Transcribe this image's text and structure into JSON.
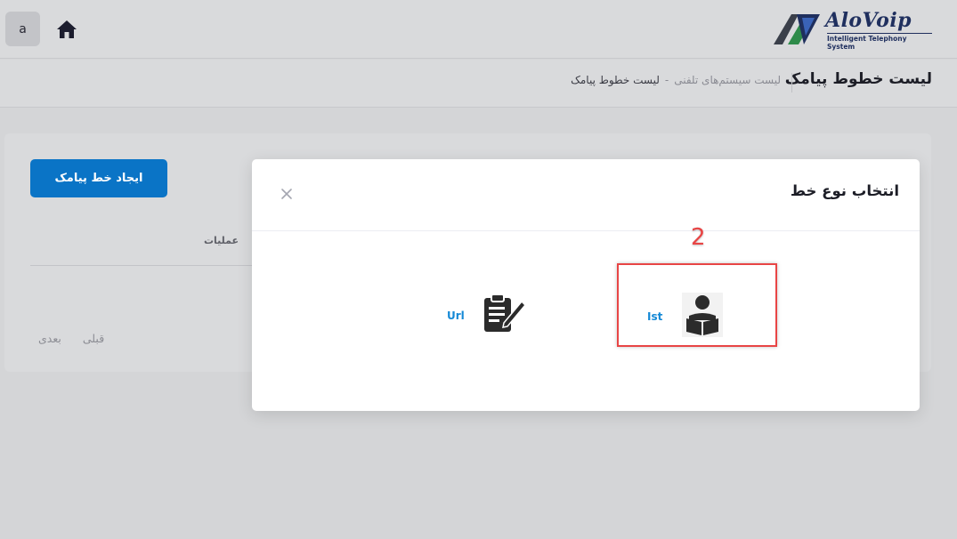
{
  "topbar": {
    "user_initial": "a",
    "logo_text": "AloVoip",
    "logo_tagline": "Intelligent Telephony System"
  },
  "header": {
    "page_title": "لیست خطوط پیامک",
    "breadcrumb": {
      "link": "لیست سیستم‌های تلفنی",
      "separator": "-",
      "current": "لیست خطوط پیامک"
    }
  },
  "card": {
    "create_button": "ایجاد خط پیامک",
    "column_header": "عملیات",
    "pager": {
      "prev": "قبلی",
      "next": "بعدی"
    }
  },
  "modal": {
    "title": "انتخاب نوع خط",
    "options": [
      {
        "label": "Url",
        "icon": "edit-document-icon"
      },
      {
        "label": "Ist",
        "icon": "person-reading-icon"
      }
    ]
  },
  "annotation": {
    "step_number": "2",
    "color": "#e84545"
  },
  "colors": {
    "primary": "#0a74c6",
    "option_link": "#1589d6",
    "title_text": "#1c1d26"
  }
}
